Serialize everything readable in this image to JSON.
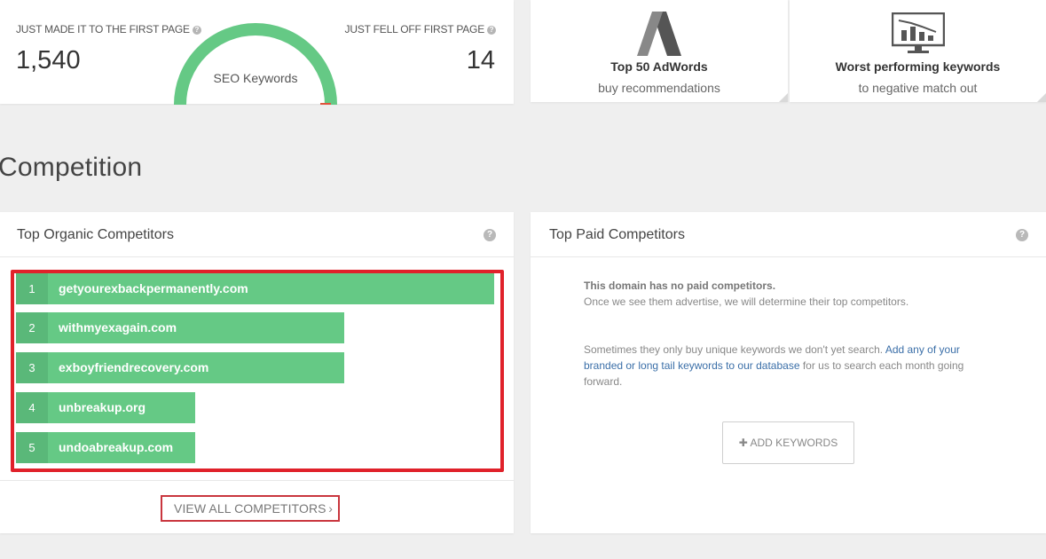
{
  "seo": {
    "made_first_page_label": "JUST MADE IT TO THE FIRST PAGE",
    "made_first_page_value": "1,540",
    "fell_off_label": "JUST FELL OFF FIRST PAGE",
    "fell_off_value": "14",
    "gauge_label": "SEO Keywords",
    "colors": {
      "green": "#65c985",
      "red": "#e0533c"
    }
  },
  "promos": [
    {
      "title": "Top 50 AdWords",
      "subtitle": "buy recommendations",
      "icon": "adwords-icon"
    },
    {
      "title": "Worst performing keywords",
      "subtitle": "to negative match out",
      "icon": "declining-chart-monitor-icon"
    }
  ],
  "section_title": "Competition",
  "organic": {
    "title": "Top Organic Competitors",
    "competitors": [
      {
        "rank": "1",
        "domain": "getyourexbackpermanently.com",
        "relative": 1.0
      },
      {
        "rank": "2",
        "domain": "withmyexagain.com",
        "relative": 0.69
      },
      {
        "rank": "3",
        "domain": "exboyfriendrecovery.com",
        "relative": 0.69
      },
      {
        "rank": "4",
        "domain": "unbreakup.org",
        "relative": 0.37
      },
      {
        "rank": "5",
        "domain": "undoabreakup.com",
        "relative": 0.37
      }
    ],
    "view_all_label": "VIEW ALL COMPETITORS",
    "view_all_chevron": "›"
  },
  "paid": {
    "title": "Top Paid Competitors",
    "no_paid_bold": "This domain has no paid competitors.",
    "no_paid_sub": "Once we see them advertise, we will determine their top competitors.",
    "sometimes_text": "Sometimes they only buy unique keywords we don't yet search.",
    "link_text": "Add any of your branded or long tail keywords to our database",
    "after_link_text": "for us to search each month going forward.",
    "add_keywords_label": "ADD KEYWORDS",
    "add_keywords_plus": "✚"
  },
  "help_glyph": "?"
}
